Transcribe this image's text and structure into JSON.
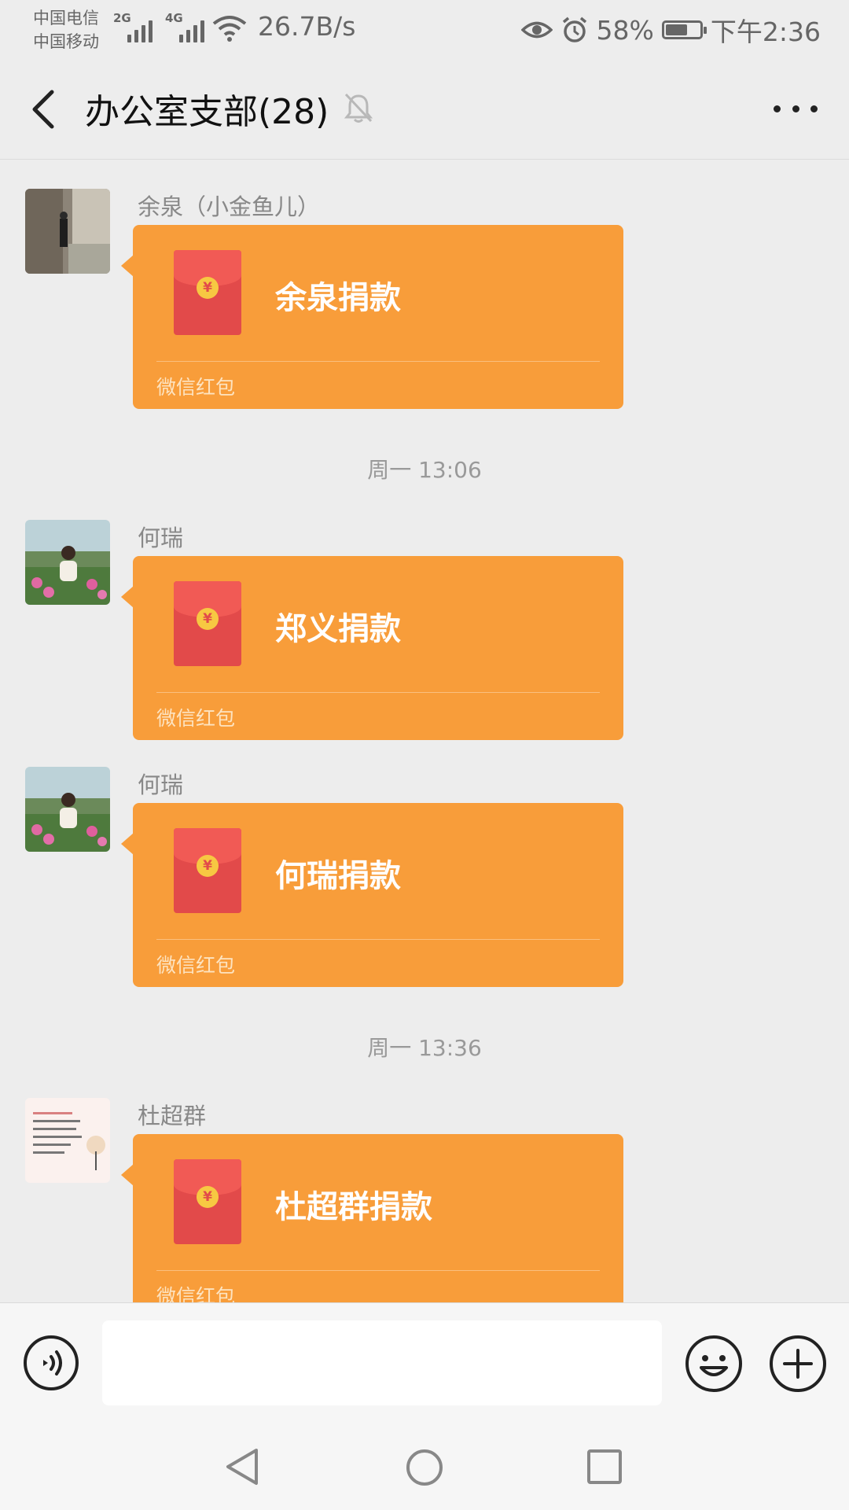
{
  "status_bar": {
    "carrier_1": "中国电信",
    "carrier_2": "中国移动",
    "sig1_tag": "2G",
    "sig2_tag": "4G",
    "net_speed": "26.7B/s",
    "battery_percent": "58%",
    "battery_level": 0.58,
    "time": "下午2:36"
  },
  "header": {
    "title": "办公室支部(28)",
    "muted": true
  },
  "messages": [
    {
      "sender": "余泉（小金鱼儿）",
      "title": "余泉捐款",
      "footer": "微信红包"
    },
    {
      "sender": "何瑞",
      "title": "郑义捐款",
      "footer": "微信红包"
    },
    {
      "sender": "何瑞",
      "title": "何瑞捐款",
      "footer": "微信红包"
    },
    {
      "sender": "杜超群",
      "title": "杜超群捐款",
      "footer": "微信红包"
    }
  ],
  "timestamps": [
    "周一 13:06",
    "周一 13:36"
  ],
  "input": {
    "value": "",
    "placeholder": ""
  },
  "colors": {
    "red_packet": "#f89d3a",
    "red_packet_icon": "#e24a4a",
    "coin": "#f7c842",
    "background": "#ededed"
  },
  "icons": {
    "back": "chevron-left-icon",
    "mute": "bell-off-icon",
    "more": "more-dots-icon",
    "voice": "voice-icon",
    "emoji": "smiley-icon",
    "plus": "plus-circle-icon"
  }
}
